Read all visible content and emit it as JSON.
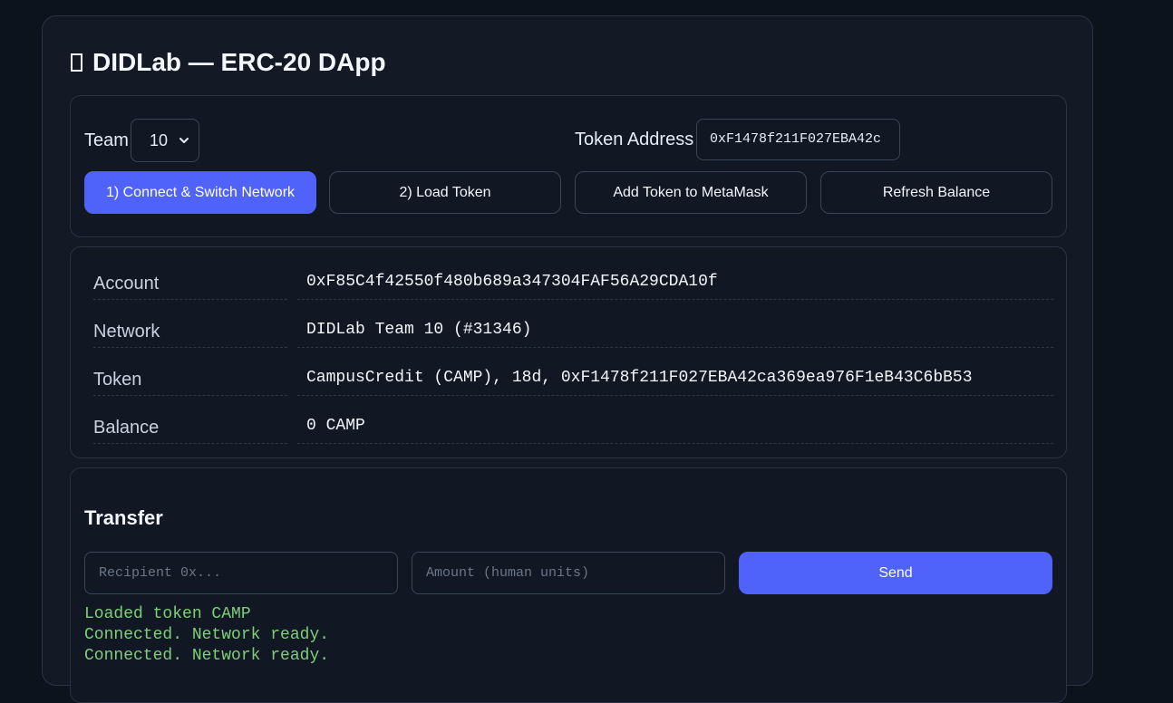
{
  "app": {
    "title": "DIDLab — ERC-20 DApp"
  },
  "controls": {
    "team_label": "Team",
    "team_selected": "10",
    "token_address_label": "Token Address",
    "token_address_value": "0xF1478f211F027EBA42c",
    "buttons": {
      "connect": "1) Connect & Switch Network",
      "load_token": "2) Load Token",
      "add_token": "Add Token to MetaMask",
      "refresh": "Refresh Balance"
    }
  },
  "info": {
    "rows": [
      {
        "key": "Account",
        "value": "0xF85C4f42550f480b689a347304FAF56A29CDA10f"
      },
      {
        "key": "Network",
        "value": "DIDLab Team 10 (#31346)"
      },
      {
        "key": "Token",
        "value": "CampusCredit (CAMP), 18d, 0xF1478f211F027EBA42ca369ea976F1eB43C6bB53"
      },
      {
        "key": "Balance",
        "value": "0 CAMP"
      }
    ]
  },
  "transfer": {
    "title": "Transfer",
    "recipient_placeholder": "Recipient 0x...",
    "amount_placeholder": "Amount (human units)",
    "send_label": "Send",
    "log": [
      "Loaded token CAMP",
      "Connected. Network ready.",
      "Connected. Network ready."
    ]
  },
  "colors": {
    "background": "#0d131d",
    "card": "#131a26",
    "accent": "#4f63fb",
    "log_text": "#7fcf7a"
  },
  "icons": {
    "title": "placeholder-glyph-icon",
    "team_dropdown": "chevron-down-icon"
  }
}
